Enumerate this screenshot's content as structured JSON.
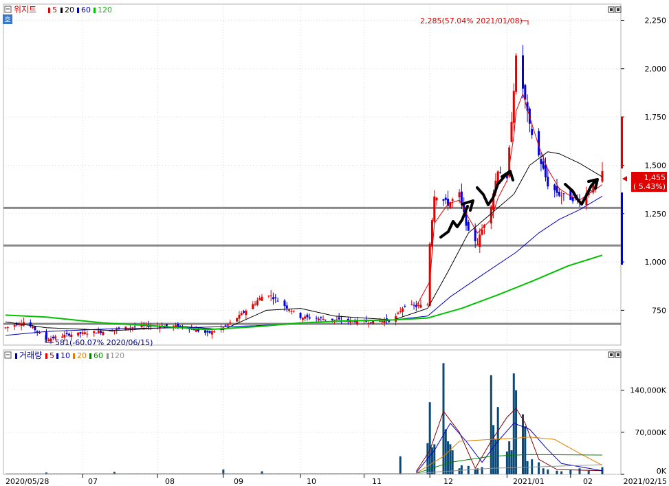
{
  "price_panel": {
    "stock_name": "위지트",
    "ma_legend": [
      {
        "label": "5",
        "color": "#e00000"
      },
      {
        "label": "20",
        "color": "#000000"
      },
      {
        "label": "60",
        "color": "#0000c0"
      },
      {
        "label": "120",
        "color": "#00c000"
      }
    ],
    "side_button": "호",
    "high_annotation": "2,285(57.04% 2021/01/08)",
    "low_annotation": "581(-60.07% 2020/06/15)",
    "current_price": "1,455",
    "current_change": "( 5.43%)"
  },
  "volume_panel": {
    "title": "거래량",
    "ma_legend": [
      {
        "label": "5",
        "color": "#e00000"
      },
      {
        "label": "10",
        "color": "#0000c0"
      },
      {
        "label": "20",
        "color": "#e08000"
      },
      {
        "label": "60",
        "color": "#008000"
      },
      {
        "label": "120",
        "color": "#909090"
      }
    ]
  },
  "x_axis": {
    "labels": [
      "2020/05/28",
      "07",
      "08",
      "09",
      "10",
      "11",
      "12",
      "2021/01",
      "02"
    ],
    "end_label": "2021/02/15"
  },
  "chart_data": [
    {
      "type": "candlestick",
      "title": "위지트",
      "y_ticks": [
        "2,250",
        "2,000",
        "1,750",
        "1,500",
        "1,250",
        "1,000",
        "750"
      ],
      "y_tick_values": [
        2250,
        2000,
        1750,
        1500,
        1250,
        1000,
        750
      ],
      "ylim": [
        570,
        2330
      ],
      "x_range": [
        "2020/05/28",
        "2021/02/15"
      ],
      "horizontal_lines": [
        1280,
        1085,
        680
      ],
      "grid": true,
      "close_path": [
        [
          "2020-05-28",
          660
        ],
        [
          "2020-06-05",
          690
        ],
        [
          "2020-06-10",
          650
        ],
        [
          "2020-06-15",
          600
        ],
        [
          "2020-06-25",
          625
        ],
        [
          "2020-07-10",
          640
        ],
        [
          "2020-07-20",
          660
        ],
        [
          "2020-08-01",
          670
        ],
        [
          "2020-08-15",
          665
        ],
        [
          "2020-08-25",
          630
        ],
        [
          "2020-09-01",
          660
        ],
        [
          "2020-09-08",
          720
        ],
        [
          "2020-09-15",
          790
        ],
        [
          "2020-09-20",
          840
        ],
        [
          "2020-09-25",
          800
        ],
        [
          "2020-10-05",
          715
        ],
        [
          "2020-10-20",
          700
        ],
        [
          "2020-11-05",
          690
        ],
        [
          "2020-11-15",
          700
        ],
        [
          "2020-11-20",
          780
        ],
        [
          "2020-11-25",
          770
        ],
        [
          "2020-11-30",
          780
        ],
        [
          "2020-12-01",
          1100
        ],
        [
          "2020-12-03",
          1350
        ],
        [
          "2020-12-09",
          1300
        ],
        [
          "2020-12-14",
          1350
        ],
        [
          "2020-12-18",
          1150
        ],
        [
          "2020-12-22",
          1100
        ],
        [
          "2020-12-28",
          1300
        ],
        [
          "2020-12-31",
          1480
        ],
        [
          "2021-01-04",
          1420
        ],
        [
          "2021-01-07",
          1900
        ],
        [
          "2021-01-08",
          2050
        ],
        [
          "2021-01-11",
          1900
        ],
        [
          "2021-01-14",
          1700
        ],
        [
          "2021-01-18",
          1550
        ],
        [
          "2021-01-22",
          1400
        ],
        [
          "2021-01-27",
          1350
        ],
        [
          "2021-02-01",
          1330
        ],
        [
          "2021-02-05",
          1320
        ],
        [
          "2021-02-10",
          1380
        ],
        [
          "2021-02-15",
          1455
        ]
      ],
      "moving_averages": [
        {
          "name": "5",
          "color": "#e00000",
          "points": [
            [
              "2020-11-25",
              770
            ],
            [
              "2020-12-01",
              900
            ],
            [
              "2020-12-03",
              1200
            ],
            [
              "2020-12-09",
              1300
            ],
            [
              "2020-12-14",
              1320
            ],
            [
              "2020-12-18",
              1230
            ],
            [
              "2020-12-22",
              1150
            ],
            [
              "2020-12-28",
              1220
            ],
            [
              "2020-12-31",
              1330
            ],
            [
              "2021-01-04",
              1420
            ],
            [
              "2021-01-07",
              1650
            ],
            [
              "2021-01-08",
              1780
            ],
            [
              "2021-01-11",
              1870
            ],
            [
              "2021-01-14",
              1750
            ],
            [
              "2021-01-18",
              1600
            ],
            [
              "2021-01-22",
              1480
            ],
            [
              "2021-01-27",
              1380
            ],
            [
              "2021-02-01",
              1340
            ],
            [
              "2021-02-05",
              1320
            ],
            [
              "2021-02-15",
              1400
            ]
          ]
        },
        {
          "name": "20",
          "color": "#000000",
          "points": [
            [
              "2020-05-28",
              690
            ],
            [
              "2020-06-15",
              660
            ],
            [
              "2020-07-15",
              645
            ],
            [
              "2020-08-15",
              665
            ],
            [
              "2020-09-01",
              650
            ],
            [
              "2020-09-20",
              750
            ],
            [
              "2020-10-05",
              760
            ],
            [
              "2020-10-20",
              720
            ],
            [
              "2020-11-15",
              700
            ],
            [
              "2020-11-30",
              760
            ],
            [
              "2020-12-09",
              950
            ],
            [
              "2020-12-18",
              1150
            ],
            [
              "2020-12-28",
              1250
            ],
            [
              "2021-01-07",
              1350
            ],
            [
              "2021-01-14",
              1500
            ],
            [
              "2021-01-22",
              1570
            ],
            [
              "2021-01-27",
              1560
            ],
            [
              "2021-02-05",
              1510
            ],
            [
              "2021-02-15",
              1440
            ]
          ]
        },
        {
          "name": "60",
          "color": "#0000c0",
          "points": [
            [
              "2020-05-28",
              620
            ],
            [
              "2020-06-15",
              640
            ],
            [
              "2020-07-15",
              655
            ],
            [
              "2020-08-15",
              660
            ],
            [
              "2020-09-15",
              670
            ],
            [
              "2020-10-15",
              690
            ],
            [
              "2020-11-15",
              700
            ],
            [
              "2020-11-30",
              720
            ],
            [
              "2020-12-10",
              820
            ],
            [
              "2020-12-25",
              940
            ],
            [
              "2021-01-08",
              1050
            ],
            [
              "2021-01-18",
              1150
            ],
            [
              "2021-01-27",
              1220
            ],
            [
              "2021-02-05",
              1270
            ],
            [
              "2021-02-15",
              1340
            ]
          ]
        },
        {
          "name": "120",
          "color": "#00c000",
          "points": [
            [
              "2020-05-28",
              725
            ],
            [
              "2020-06-15",
              715
            ],
            [
              "2020-07-10",
              685
            ],
            [
              "2020-08-01",
              670
            ],
            [
              "2020-08-25",
              650
            ],
            [
              "2020-09-15",
              665
            ],
            [
              "2020-10-05",
              685
            ],
            [
              "2020-10-25",
              695
            ],
            [
              "2020-11-15",
              700
            ],
            [
              "2020-11-30",
              710
            ],
            [
              "2020-12-15",
              760
            ],
            [
              "2020-12-31",
              830
            ],
            [
              "2021-01-15",
              900
            ],
            [
              "2021-01-31",
              980
            ],
            [
              "2021-02-15",
              1035
            ]
          ]
        }
      ]
    },
    {
      "type": "bar",
      "title": "거래량",
      "y_ticks": [
        "140,000K",
        "70,000K",
        "0K"
      ],
      "y_tick_values": [
        140000,
        70000,
        0
      ],
      "ylim": [
        0,
        190000
      ],
      "unit": "K",
      "bars": [
        [
          "2020-06-15",
          3000
        ],
        [
          "2020-07-15",
          4000
        ],
        [
          "2020-09-01",
          8000
        ],
        [
          "2020-09-18",
          5000
        ],
        [
          "2020-11-18",
          30000
        ],
        [
          "2020-11-30",
          52000
        ],
        [
          "2020-12-01",
          120000
        ],
        [
          "2020-12-02",
          45000
        ],
        [
          "2020-12-03",
          50000
        ],
        [
          "2020-12-07",
          185000
        ],
        [
          "2020-12-08",
          75000
        ],
        [
          "2020-12-09",
          55000
        ],
        [
          "2020-12-10",
          50000
        ],
        [
          "2020-12-11",
          40000
        ],
        [
          "2020-12-14",
          10000
        ],
        [
          "2020-12-15",
          15000
        ],
        [
          "2020-12-18",
          14000
        ],
        [
          "2020-12-21",
          8000
        ],
        [
          "2020-12-22",
          10000
        ],
        [
          "2020-12-24",
          12000
        ],
        [
          "2020-12-28",
          165000
        ],
        [
          "2020-12-29",
          82000
        ],
        [
          "2020-12-30",
          58000
        ],
        [
          "2020-12-31",
          112000
        ],
        [
          "2021-01-04",
          38000
        ],
        [
          "2021-01-05",
          55000
        ],
        [
          "2021-01-06",
          40000
        ],
        [
          "2021-01-07",
          168000
        ],
        [
          "2021-01-08",
          140000
        ],
        [
          "2021-01-11",
          100000
        ],
        [
          "2021-01-12",
          80000
        ],
        [
          "2021-01-13",
          22000
        ],
        [
          "2021-01-15",
          25000
        ],
        [
          "2021-01-18",
          20000
        ],
        [
          "2021-01-20",
          10000
        ],
        [
          "2021-01-22",
          8000
        ],
        [
          "2021-01-26",
          6000
        ],
        [
          "2021-01-28",
          5000
        ],
        [
          "2021-02-01",
          8000
        ],
        [
          "2021-02-05",
          10000
        ],
        [
          "2021-02-09",
          6000
        ],
        [
          "2021-02-15",
          12000
        ]
      ],
      "moving_averages": [
        {
          "name": "5",
          "color": "#800000",
          "points": [
            [
              "2020-11-25",
              5000
            ],
            [
              "2020-12-01",
              40000
            ],
            [
              "2020-12-07",
              105000
            ],
            [
              "2020-12-14",
              70000
            ],
            [
              "2020-12-21",
              10000
            ],
            [
              "2020-12-28",
              55000
            ],
            [
              "2021-01-04",
              95000
            ],
            [
              "2021-01-08",
              110000
            ],
            [
              "2021-01-12",
              85000
            ],
            [
              "2021-01-18",
              25000
            ],
            [
              "2021-01-26",
              8000
            ],
            [
              "2021-02-15",
              6000
            ]
          ]
        },
        {
          "name": "10",
          "color": "#0000c0",
          "points": [
            [
              "2020-11-25",
              3000
            ],
            [
              "2020-12-03",
              40000
            ],
            [
              "2020-12-10",
              85000
            ],
            [
              "2020-12-17",
              55000
            ],
            [
              "2020-12-24",
              20000
            ],
            [
              "2020-12-31",
              55000
            ],
            [
              "2021-01-07",
              85000
            ],
            [
              "2021-01-14",
              75000
            ],
            [
              "2021-01-21",
              45000
            ],
            [
              "2021-01-28",
              18000
            ],
            [
              "2021-02-15",
              6000
            ]
          ]
        },
        {
          "name": "20",
          "color": "#e08000",
          "points": [
            [
              "2020-11-25",
              2000
            ],
            [
              "2020-12-07",
              30000
            ],
            [
              "2020-12-14",
              55000
            ],
            [
              "2020-12-28",
              58000
            ],
            [
              "2021-01-07",
              60000
            ],
            [
              "2021-01-14",
              62000
            ],
            [
              "2021-01-25",
              58000
            ],
            [
              "2021-02-05",
              35000
            ],
            [
              "2021-02-15",
              15000
            ]
          ]
        },
        {
          "name": "60",
          "color": "#008000",
          "points": [
            [
              "2020-11-25",
              1500
            ],
            [
              "2020-12-10",
              20000
            ],
            [
              "2020-12-28",
              30000
            ],
            [
              "2021-01-14",
              33000
            ],
            [
              "2021-02-15",
              32000
            ]
          ]
        },
        {
          "name": "120",
          "color": "#909090",
          "points": [
            [
              "2020-05-28",
              1000
            ],
            [
              "2020-11-25",
              1500
            ],
            [
              "2020-12-28",
              10000
            ],
            [
              "2021-02-15",
              16000
            ]
          ]
        }
      ]
    }
  ]
}
